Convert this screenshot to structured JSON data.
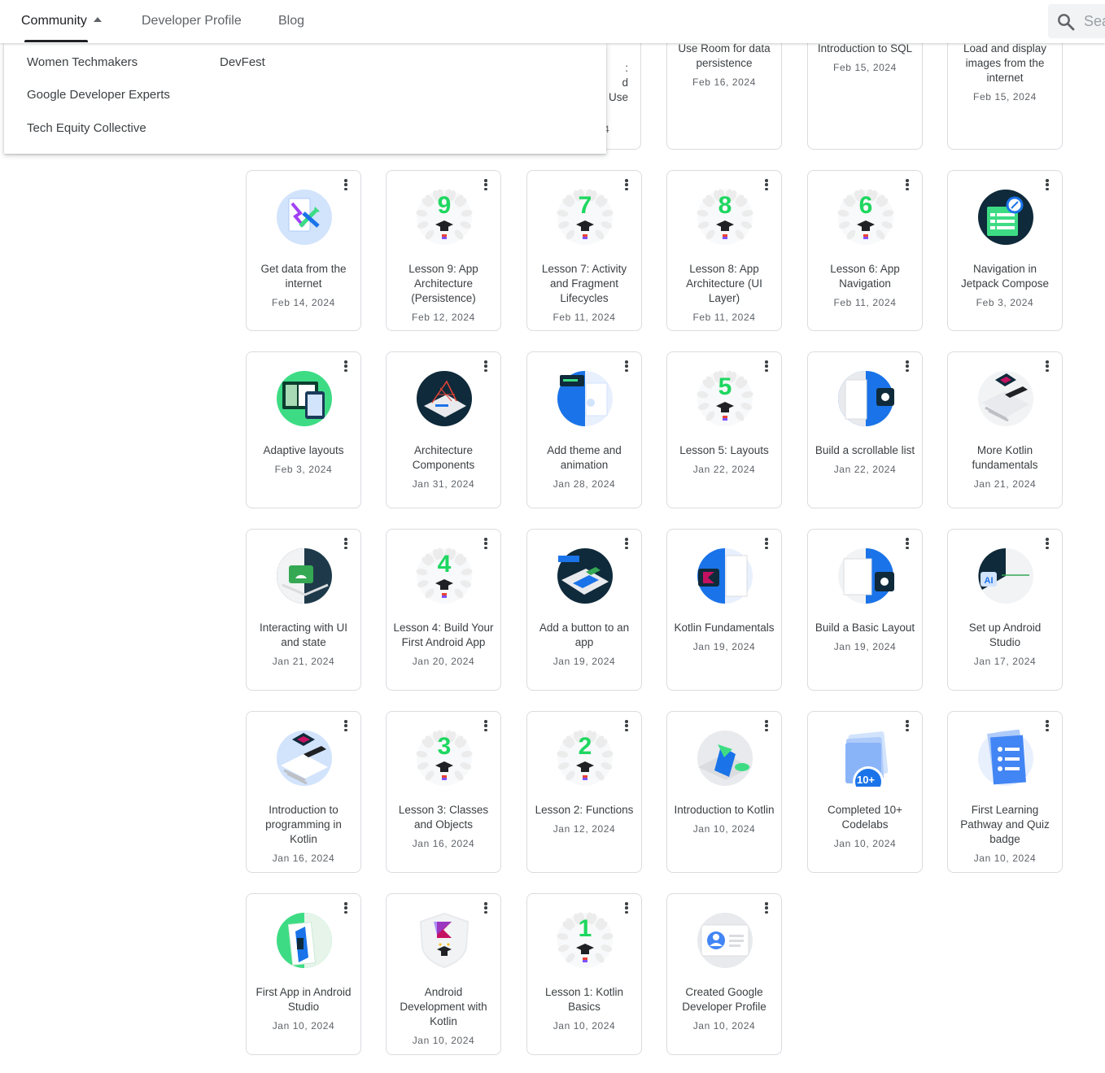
{
  "nav": {
    "tabs": [
      {
        "label": "Community"
      },
      {
        "label": "Developer Profile"
      },
      {
        "label": "Blog"
      }
    ],
    "search_placeholder": "Search"
  },
  "dropdown": {
    "items": [
      "Women Techmakers",
      "DevFest",
      "Google Developer Experts",
      "Tech Equity Collective"
    ]
  },
  "partial_card": {
    "fragments": [
      ":",
      "d",
      "Use",
      "4"
    ]
  },
  "badges": [
    {
      "title": "Use Room for data persistence",
      "date": "Feb 16, 2024",
      "icon": "room-icon"
    },
    {
      "title": "Introduction to SQL",
      "date": "Feb 15, 2024",
      "icon": "sql-icon"
    },
    {
      "title": "Load and display images from the internet",
      "date": "Feb 15, 2024",
      "icon": "images-icon"
    },
    {
      "title": "Get data from the internet",
      "date": "Feb 14, 2024",
      "icon": "internet-icon"
    },
    {
      "title": "Lesson 9: App Architecture (Persistence)",
      "date": "Feb 12, 2024",
      "icon": "lesson-icon",
      "number": "9"
    },
    {
      "title": "Lesson 7: Activity and Fragment Lifecycles",
      "date": "Feb 11, 2024",
      "icon": "lesson-icon",
      "number": "7"
    },
    {
      "title": "Lesson 8: App Architecture (UI Layer)",
      "date": "Feb 11, 2024",
      "icon": "lesson-icon",
      "number": "8"
    },
    {
      "title": "Lesson 6: App Navigation",
      "date": "Feb 11, 2024",
      "icon": "lesson-icon",
      "number": "6"
    },
    {
      "title": "Navigation in Jetpack Compose",
      "date": "Feb 3, 2024",
      "icon": "navigation-icon"
    },
    {
      "title": "Adaptive layouts",
      "date": "Feb 3, 2024",
      "icon": "adaptive-icon"
    },
    {
      "title": "Architecture Components",
      "date": "Jan 31, 2024",
      "icon": "architecture-icon"
    },
    {
      "title": "Add theme and animation",
      "date": "Jan 28, 2024",
      "icon": "theme-icon"
    },
    {
      "title": "Lesson 5: Layouts",
      "date": "Jan 22, 2024",
      "icon": "lesson-icon",
      "number": "5"
    },
    {
      "title": "Build a scrollable list",
      "date": "Jan 22, 2024",
      "icon": "scroll-list-icon"
    },
    {
      "title": "More Kotlin fundamentals",
      "date": "Jan 21, 2024",
      "icon": "kotlin-more-icon"
    },
    {
      "title": "Interacting with UI and state",
      "date": "Jan 21, 2024",
      "icon": "ui-state-icon"
    },
    {
      "title": "Lesson 4: Build Your First Android App",
      "date": "Jan 20, 2024",
      "icon": "lesson-icon",
      "number": "4"
    },
    {
      "title": "Add a button to an app",
      "date": "Jan 19, 2024",
      "icon": "button-app-icon"
    },
    {
      "title": "Kotlin Fundamentals",
      "date": "Jan 19, 2024",
      "icon": "kotlin-fund-icon"
    },
    {
      "title": "Build a Basic Layout",
      "date": "Jan 19, 2024",
      "icon": "basic-layout-icon"
    },
    {
      "title": "Set up Android Studio",
      "date": "Jan 17, 2024",
      "icon": "studio-setup-icon"
    },
    {
      "title": "Introduction to programming in Kotlin",
      "date": "Jan 16, 2024",
      "icon": "kotlin-intro-prog-icon"
    },
    {
      "title": "Lesson 3: Classes and Objects",
      "date": "Jan 16, 2024",
      "icon": "lesson-icon",
      "number": "3"
    },
    {
      "title": "Lesson 2: Functions",
      "date": "Jan 12, 2024",
      "icon": "lesson-icon",
      "number": "2"
    },
    {
      "title": "Introduction to Kotlin",
      "date": "Jan 10, 2024",
      "icon": "kotlin-intro-icon"
    },
    {
      "title": "Completed 10+ Codelabs",
      "date": "Jan 10, 2024",
      "icon": "codelabs-icon",
      "number": "10+"
    },
    {
      "title": "First Learning Pathway and Quiz badge",
      "date": "Jan 10, 2024",
      "icon": "pathway-icon"
    },
    {
      "title": "First App in Android Studio",
      "date": "Jan 10, 2024",
      "icon": "first-app-icon"
    },
    {
      "title": "Android Development with Kotlin",
      "date": "Jan 10, 2024",
      "icon": "android-kotlin-icon"
    },
    {
      "title": "Lesson 1: Kotlin Basics",
      "date": "Jan 10, 2024",
      "icon": "lesson-icon",
      "number": "1"
    },
    {
      "title": "Created Google Developer Profile",
      "date": "Jan 10, 2024",
      "icon": "profile-icon"
    }
  ],
  "colors": {
    "lesson_green": "#1ed760",
    "google_blue": "#4285f4",
    "android_green": "#3ddc84",
    "dark_navy": "#0f2a3a"
  }
}
